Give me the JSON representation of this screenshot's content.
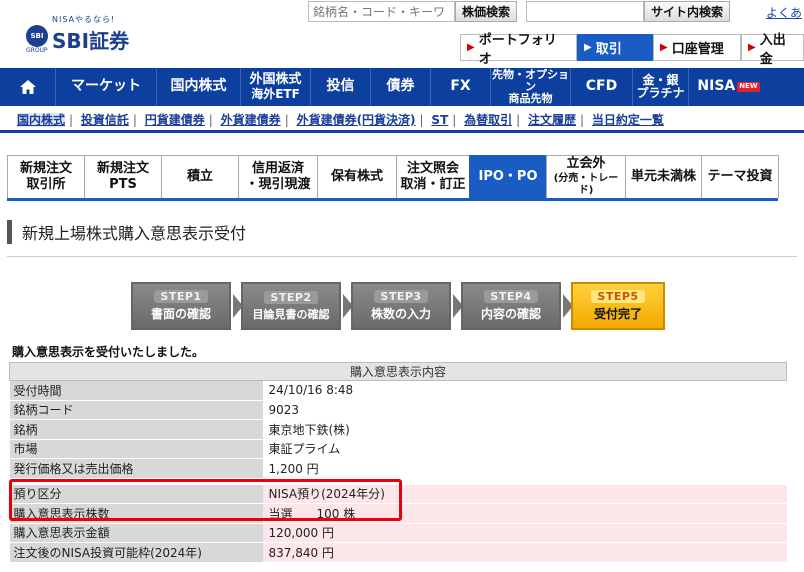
{
  "header": {
    "logo_tag": "NISAやるなら!",
    "logo_mark": "SBI",
    "logo_name": "SBI証券",
    "logo_group": "GROUP",
    "search_placeholder": "銘柄名・コード・キーワ",
    "stock_search_label": "株価検索",
    "site_search_label": "サイト内検索",
    "help_link": "よくあ"
  },
  "top_nav": [
    {
      "label": "ポートフォリオ",
      "active": false
    },
    {
      "label": "取引",
      "active": true
    },
    {
      "label": "口座管理",
      "active": false
    },
    {
      "label": "入出金",
      "active": false
    }
  ],
  "main_menu": {
    "home_icon": "home-icon",
    "market": "マーケット",
    "domestic_stock": "国内株式",
    "foreign_stock_1": "外国株式",
    "foreign_stock_2": "海外ETF",
    "investment_trust": "投信",
    "bonds": "債券",
    "fx": "FX",
    "futures_1": "先物・オプション",
    "futures_2": "商品先物",
    "cfd": "CFD",
    "gold_1": "金・銀",
    "gold_2": "プラチナ",
    "nisa": "NISA",
    "nisa_badge": "NEW"
  },
  "sub_links": [
    "国内株式",
    "投資信託",
    "円貨建債券",
    "外貨建債券",
    "外貨建債券(円貨決済)",
    "ST",
    "為替取引",
    "注文履歴",
    "当日約定一覧"
  ],
  "tabs": {
    "t1a": "新規注文",
    "t1b": "取引所",
    "t2a": "新規注文",
    "t2b": "PTS",
    "t3": "積立",
    "t4a": "信用返済",
    "t4b": "・現引現渡",
    "t5": "保有株式",
    "t6a": "注文照会",
    "t6b": "取消・訂正",
    "t7": "IPO・PO",
    "t8a": "立会外",
    "t8b": "(分売・トレード)",
    "t9": "単元未満株",
    "t10": "テーマ投資"
  },
  "page_title": "新規上場株式購入意思表示受付",
  "steps": [
    {
      "step": "STEP1",
      "label": "書面の確認"
    },
    {
      "step": "STEP2",
      "label": "目論見書の確認"
    },
    {
      "step": "STEP3",
      "label": "株数の入力"
    },
    {
      "step": "STEP4",
      "label": "内容の確認"
    },
    {
      "step": "STEP5",
      "label": "受付完了"
    }
  ],
  "accepted_message": "購入意思表示を受付いたしました。",
  "detail": {
    "header": "購入意思表示内容",
    "rows": [
      {
        "label": "受付時間",
        "value": "24/10/16 8:48"
      },
      {
        "label": "銘柄コード",
        "value": "9023"
      },
      {
        "label": "銘柄",
        "value": "東京地下鉄(株)"
      },
      {
        "label": "市場",
        "value": "東証プライム"
      },
      {
        "label": "発行価格又は売出価格",
        "value": "1,200 円"
      }
    ],
    "pink_rows": [
      {
        "label": "預り区分",
        "value": "NISA預り(2024年分)"
      },
      {
        "label": "購入意思表示株数",
        "value": "当選　　100 株"
      },
      {
        "label": "購入意思表示金額",
        "value": "120,000 円"
      },
      {
        "label": "注文後のNISA投資可能枠(2024年)",
        "value": "837,840 円"
      }
    ]
  },
  "colors": {
    "brand_blue": "#0d3f9e",
    "active_blue": "#1a5bc4",
    "highlight_red": "#e8000b",
    "step_done": "#f4a800"
  }
}
